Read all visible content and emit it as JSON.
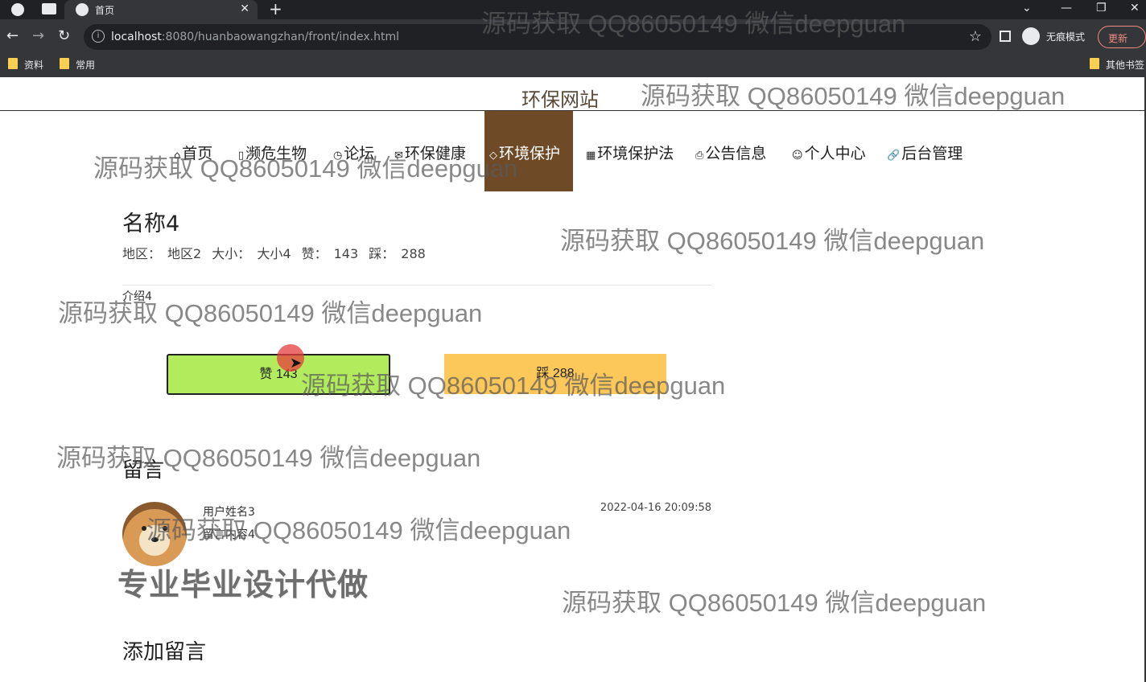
{
  "browser": {
    "tab_title": "首页",
    "url_host": "localhost",
    "url_path": ":8080/huanbaowangzhan/front/index.html",
    "profile_label": "无痕模式",
    "update_label": "更新",
    "bookmarks": [
      "资料",
      "常用"
    ],
    "other_bookmarks": "其他书签"
  },
  "site": {
    "title": "环保网站",
    "nav": [
      {
        "label": "首页",
        "icon": "home-icon"
      },
      {
        "label": "濒危生物",
        "icon": "book-icon"
      },
      {
        "label": "论坛",
        "icon": "clock-icon"
      },
      {
        "label": "环保健康",
        "icon": "mail-icon"
      },
      {
        "label": "环境保护",
        "icon": "tag-icon",
        "active": true
      },
      {
        "label": "环境保护法",
        "icon": "grid-icon"
      },
      {
        "label": "公告信息",
        "icon": "print-icon"
      },
      {
        "label": "个人中心",
        "icon": "user-icon"
      },
      {
        "label": "后台管理",
        "icon": "link-icon"
      }
    ]
  },
  "detail": {
    "title": "名称4",
    "region_label": "地区：",
    "region_value": "地区2",
    "size_label": "大小：",
    "size_value": "大小4",
    "like_label": "赞：",
    "like_value": "143",
    "dislike_label": "踩：",
    "dislike_value": "288",
    "intro": "介绍4",
    "like_button": "赞  143",
    "dislike_button": "踩  288"
  },
  "comments": {
    "heading": "留言",
    "items": [
      {
        "user": "用户姓名3",
        "content": "留言内容4",
        "time": "2022-04-16 20:09:58"
      }
    ],
    "add_heading": "添加留言"
  },
  "overlay": {
    "watermark": "源码获取 QQ86050149 微信deepguan",
    "stamp": "专业毕业设计代做"
  },
  "colors": {
    "nav_active_bg": "#6e4a27",
    "like_bg": "#b2ec5d",
    "dislike_bg": "#fcc85a"
  }
}
